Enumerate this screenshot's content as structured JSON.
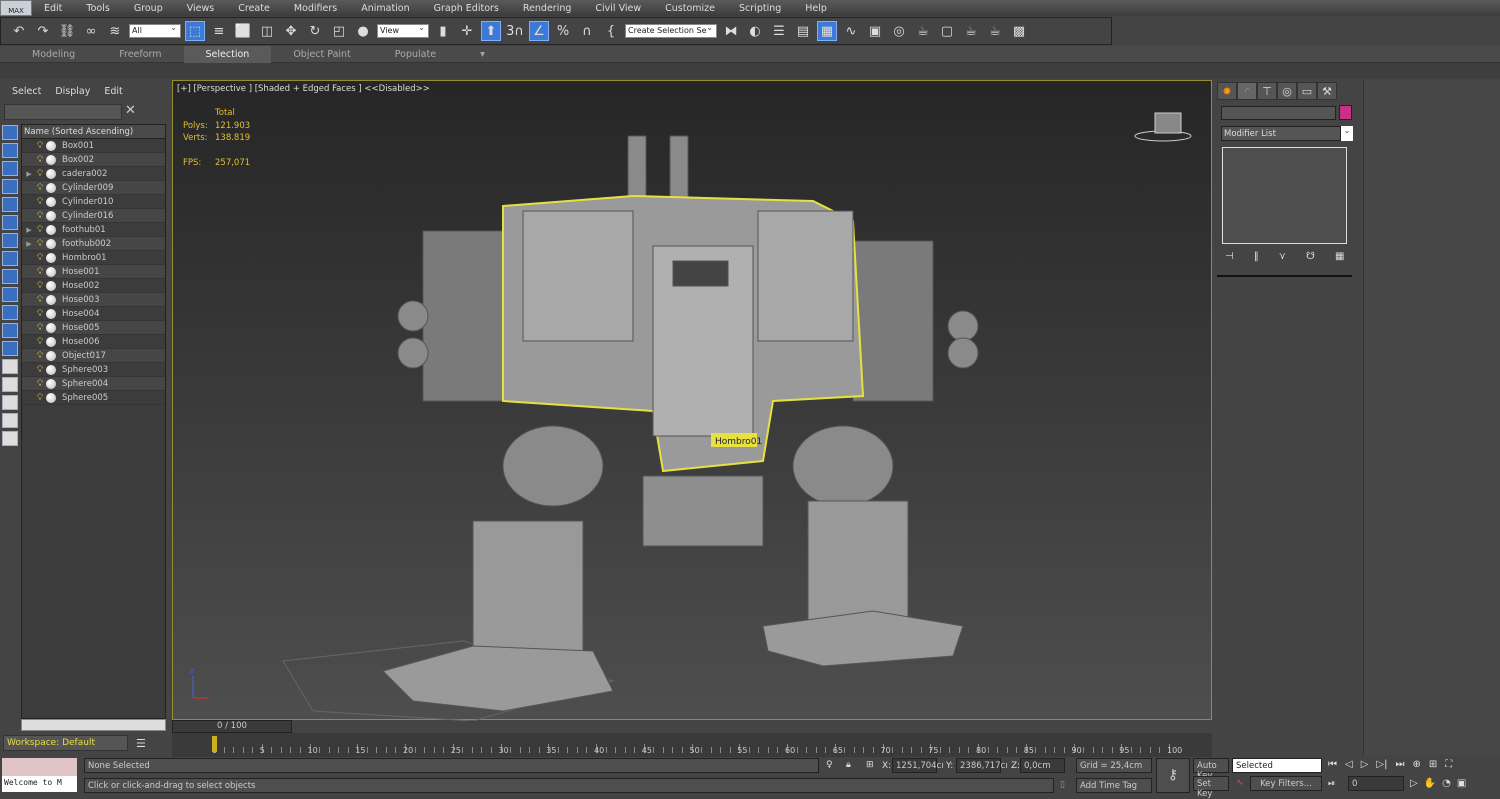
{
  "app": {
    "logo": "MAX"
  },
  "menu": [
    "Edit",
    "Tools",
    "Group",
    "Views",
    "Create",
    "Modifiers",
    "Animation",
    "Graph Editors",
    "Rendering",
    "Civil View",
    "Customize",
    "Scripting",
    "Help"
  ],
  "toolbar": {
    "filter": "All",
    "ref_coord": "View",
    "named_selection": "Create Selection Se",
    "snap_label": "3"
  },
  "ribbon": {
    "tabs": [
      "Modeling",
      "Freeform",
      "Selection",
      "Object Paint",
      "Populate"
    ],
    "active": "Selection"
  },
  "explorer": {
    "menu": [
      "Select",
      "Display",
      "Edit"
    ],
    "header": "Name (Sorted Ascending)",
    "items": [
      {
        "name": "Box001",
        "children": false
      },
      {
        "name": "Box002",
        "children": false
      },
      {
        "name": "cadera002",
        "children": true
      },
      {
        "name": "Cylinder009",
        "children": false
      },
      {
        "name": "Cylinder010",
        "children": false
      },
      {
        "name": "Cylinder016",
        "children": false
      },
      {
        "name": "foothub01",
        "children": true
      },
      {
        "name": "foothub002",
        "children": true
      },
      {
        "name": "Hombro01",
        "children": false
      },
      {
        "name": "Hose001",
        "children": false
      },
      {
        "name": "Hose002",
        "children": false
      },
      {
        "name": "Hose003",
        "children": false
      },
      {
        "name": "Hose004",
        "children": false
      },
      {
        "name": "Hose005",
        "children": false
      },
      {
        "name": "Hose006",
        "children": false
      },
      {
        "name": "Object017",
        "children": false
      },
      {
        "name": "Sphere003",
        "children": false
      },
      {
        "name": "Sphere004",
        "children": false
      },
      {
        "name": "Sphere005",
        "children": false
      }
    ],
    "workspace": "Workspace: Default"
  },
  "viewport": {
    "label": "[+] [Perspective ] [Shaded + Edged Faces ]  <<Disabled>>",
    "stats_total": "Total",
    "polys_label": "Polys:",
    "polys": "121.903",
    "verts_label": "Verts:",
    "verts": "138.819",
    "fps_label": "FPS:",
    "fps": "257,071",
    "tooltip": "Hombro01",
    "selection_color": "#e6e040",
    "axis": {
      "z": "z",
      "x": "x",
      "y": "y"
    }
  },
  "timeline": {
    "slider": "0 / 100",
    "ticks": [
      "0",
      "5",
      "10",
      "15",
      "20",
      "25",
      "30",
      "35",
      "40",
      "45",
      "50",
      "55",
      "60",
      "65",
      "70",
      "75",
      "80",
      "85",
      "90",
      "95",
      "100"
    ]
  },
  "status": {
    "maxscript": "Welcome to M",
    "selection": "None Selected",
    "prompt": "Click or click-and-drag to select objects",
    "x_label": "X:",
    "x": "1251,704cı",
    "y_label": "Y:",
    "y": "2386,717cı",
    "z_label": "Z:",
    "z": "0,0cm",
    "grid": "Grid = 25,4cm",
    "add_time_tag": "Add Time Tag",
    "auto_key": "Auto Key",
    "set_key": "Set Key",
    "key_mode": "Selected",
    "key_filters": "Key Filters...",
    "frame": "0"
  },
  "command_panel": {
    "modifier_list": "Modifier List",
    "object_color": "#c8308a"
  }
}
